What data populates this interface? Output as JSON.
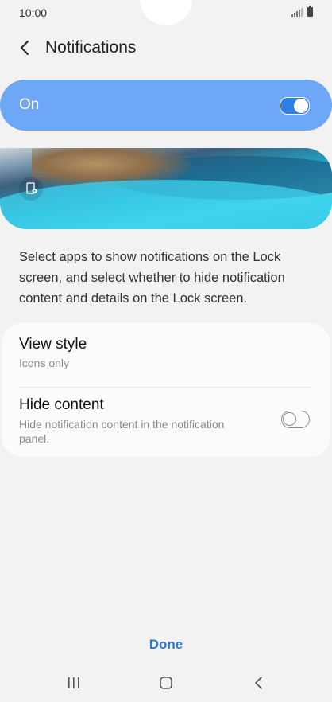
{
  "status_bar": {
    "time": "10:00"
  },
  "header": {
    "title": "Notifications"
  },
  "master_switch": {
    "label": "On",
    "enabled": true
  },
  "description": "Select apps to show notifications on the Lock screen, and select whether to hide notification content and details on the Lock screen.",
  "settings": {
    "view_style": {
      "title": "View style",
      "value": "Icons only"
    },
    "hide_content": {
      "title": "Hide content",
      "subtitle": "Hide notification content in the notification panel.",
      "enabled": false
    }
  },
  "footer": {
    "done_label": "Done"
  },
  "colors": {
    "accent": "#2b7ad6",
    "master_bar": "#6fa7f7",
    "background": "#f2f2f2"
  },
  "icons": {
    "back": "chevron-left-icon",
    "preview_settings": "lockscreen-settings-icon",
    "nav_recents": "recents-icon",
    "nav_home": "home-icon",
    "nav_back": "back-nav-icon"
  }
}
